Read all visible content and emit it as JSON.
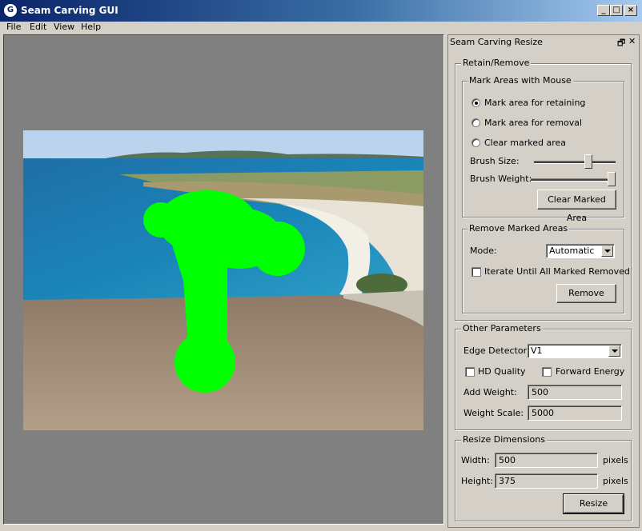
{
  "window": {
    "title": "Seam Carving GUI",
    "app_icon_letter": "G"
  },
  "menu": [
    "File",
    "Edit",
    "View",
    "Help"
  ],
  "panel": {
    "title": "Seam Carving Resize",
    "retain_remove": {
      "legend": "Retain/Remove",
      "mark_areas": {
        "legend": "Mark Areas with Mouse",
        "options": [
          "Mark area for retaining",
          "Mark area for removal",
          "Clear marked area"
        ],
        "selected_index": 0,
        "brush_size_label": "Brush Size:",
        "brush_size_level": 0.68,
        "brush_weight_label": "Brush Weight:",
        "brush_weight_level": 1.0,
        "clear_button": "Clear Marked Area"
      },
      "remove_marked": {
        "legend": "Remove Marked Areas",
        "mode_label": "Mode:",
        "mode_value": "Automatic",
        "iterate_label": "Iterate Until All Marked Removed",
        "iterate_checked": false,
        "remove_button": "Remove"
      }
    },
    "other_params": {
      "legend": "Other Parameters",
      "edge_detector_label": "Edge Detector:",
      "edge_detector_value": "V1",
      "hd_quality_label": "HD Quality",
      "forward_energy_label": "Forward Energy",
      "add_weight_label": "Add Weight:",
      "add_weight_value": "500",
      "weight_scale_label": "Weight Scale:",
      "weight_scale_value": "5000"
    },
    "resize_dims": {
      "legend": "Resize Dimensions",
      "width_label": "Width:",
      "width_value": "500",
      "height_label": "Height:",
      "height_value": "375",
      "pixels_label": "pixels",
      "resize_button": "Resize"
    }
  },
  "colors": {
    "marker_green": "#00ff00",
    "canvas_bg": "#808080"
  }
}
